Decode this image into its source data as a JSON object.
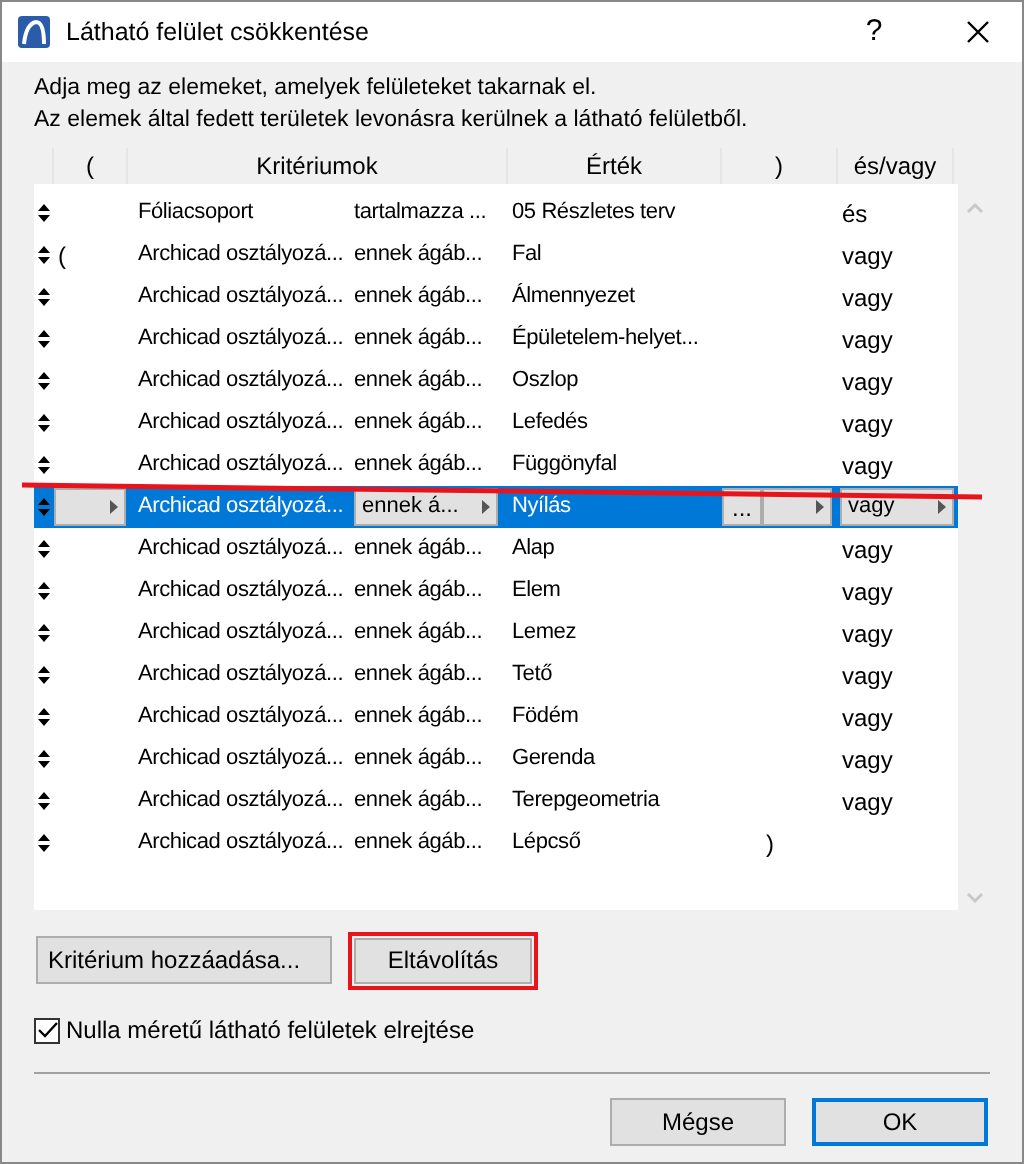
{
  "window": {
    "title": "Látható felület csökkentése",
    "help": "?"
  },
  "description": [
    "Adja meg az elemeket, amelyek felületeket takarnak el.",
    "Az elemek által fedett területek levonásra kerülnek a látható felületből."
  ],
  "table": {
    "columns": [
      "(",
      "Kritériumok",
      "Érték",
      ")",
      "és/vagy"
    ],
    "rows": [
      {
        "open_paren": "",
        "criterion": "Fóliacsoport",
        "operator": "tartalmazza ...",
        "value": "05 Részletes terv",
        "close_paren": "",
        "conjunction": "és",
        "selected": false
      },
      {
        "open_paren": "(",
        "criterion": "Archicad osztályozá...",
        "operator": "ennek ágáb...",
        "value": "Fal",
        "close_paren": "",
        "conjunction": "vagy",
        "selected": false
      },
      {
        "open_paren": "",
        "criterion": "Archicad osztályozá...",
        "operator": "ennek ágáb...",
        "value": "Álmennyezet",
        "close_paren": "",
        "conjunction": "vagy",
        "selected": false
      },
      {
        "open_paren": "",
        "criterion": "Archicad osztályozá...",
        "operator": "ennek ágáb...",
        "value": "Épületelem-helyet...",
        "close_paren": "",
        "conjunction": "vagy",
        "selected": false
      },
      {
        "open_paren": "",
        "criterion": "Archicad osztályozá...",
        "operator": "ennek ágáb...",
        "value": "Oszlop",
        "close_paren": "",
        "conjunction": "vagy",
        "selected": false
      },
      {
        "open_paren": "",
        "criterion": "Archicad osztályozá...",
        "operator": "ennek ágáb...",
        "value": "Lefedés",
        "close_paren": "",
        "conjunction": "vagy",
        "selected": false
      },
      {
        "open_paren": "",
        "criterion": "Archicad osztályozá...",
        "operator": "ennek ágáb...",
        "value": "Függönyfal",
        "close_paren": "",
        "conjunction": "vagy",
        "selected": false
      },
      {
        "open_paren": "",
        "criterion": "Archicad osztályozá...",
        "operator": "ennek á...",
        "value": "Nyílás",
        "close_paren": "",
        "conjunction": "vagy",
        "selected": true,
        "value_button": "..."
      },
      {
        "open_paren": "",
        "criterion": "Archicad osztályozá...",
        "operator": "ennek ágáb...",
        "value": "Alap",
        "close_paren": "",
        "conjunction": "vagy",
        "selected": false
      },
      {
        "open_paren": "",
        "criterion": "Archicad osztályozá...",
        "operator": "ennek ágáb...",
        "value": "Elem",
        "close_paren": "",
        "conjunction": "vagy",
        "selected": false
      },
      {
        "open_paren": "",
        "criterion": "Archicad osztályozá...",
        "operator": "ennek ágáb...",
        "value": "Lemez",
        "close_paren": "",
        "conjunction": "vagy",
        "selected": false
      },
      {
        "open_paren": "",
        "criterion": "Archicad osztályozá...",
        "operator": "ennek ágáb...",
        "value": "Tető",
        "close_paren": "",
        "conjunction": "vagy",
        "selected": false
      },
      {
        "open_paren": "",
        "criterion": "Archicad osztályozá...",
        "operator": "ennek ágáb...",
        "value": "Födém",
        "close_paren": "",
        "conjunction": "vagy",
        "selected": false
      },
      {
        "open_paren": "",
        "criterion": "Archicad osztályozá...",
        "operator": "ennek ágáb...",
        "value": "Gerenda",
        "close_paren": "",
        "conjunction": "vagy",
        "selected": false
      },
      {
        "open_paren": "",
        "criterion": "Archicad osztályozá...",
        "operator": "ennek ágáb...",
        "value": "Terepgeometria",
        "close_paren": "",
        "conjunction": "vagy",
        "selected": false
      },
      {
        "open_paren": "",
        "criterion": "Archicad osztályozá...",
        "operator": "ennek ágáb...",
        "value": "Lépcső",
        "close_paren": ")",
        "conjunction": "",
        "selected": false
      }
    ]
  },
  "add_button": "Kritérium hozzáadása...",
  "remove_button": "Eltávolítás",
  "hide_zero_checkbox": {
    "label": "Nulla méretű látható felületek elrejtése",
    "checked": true
  },
  "buttons": [
    {
      "label": "Mégse",
      "default": false
    },
    {
      "label": "OK",
      "default": true
    }
  ]
}
